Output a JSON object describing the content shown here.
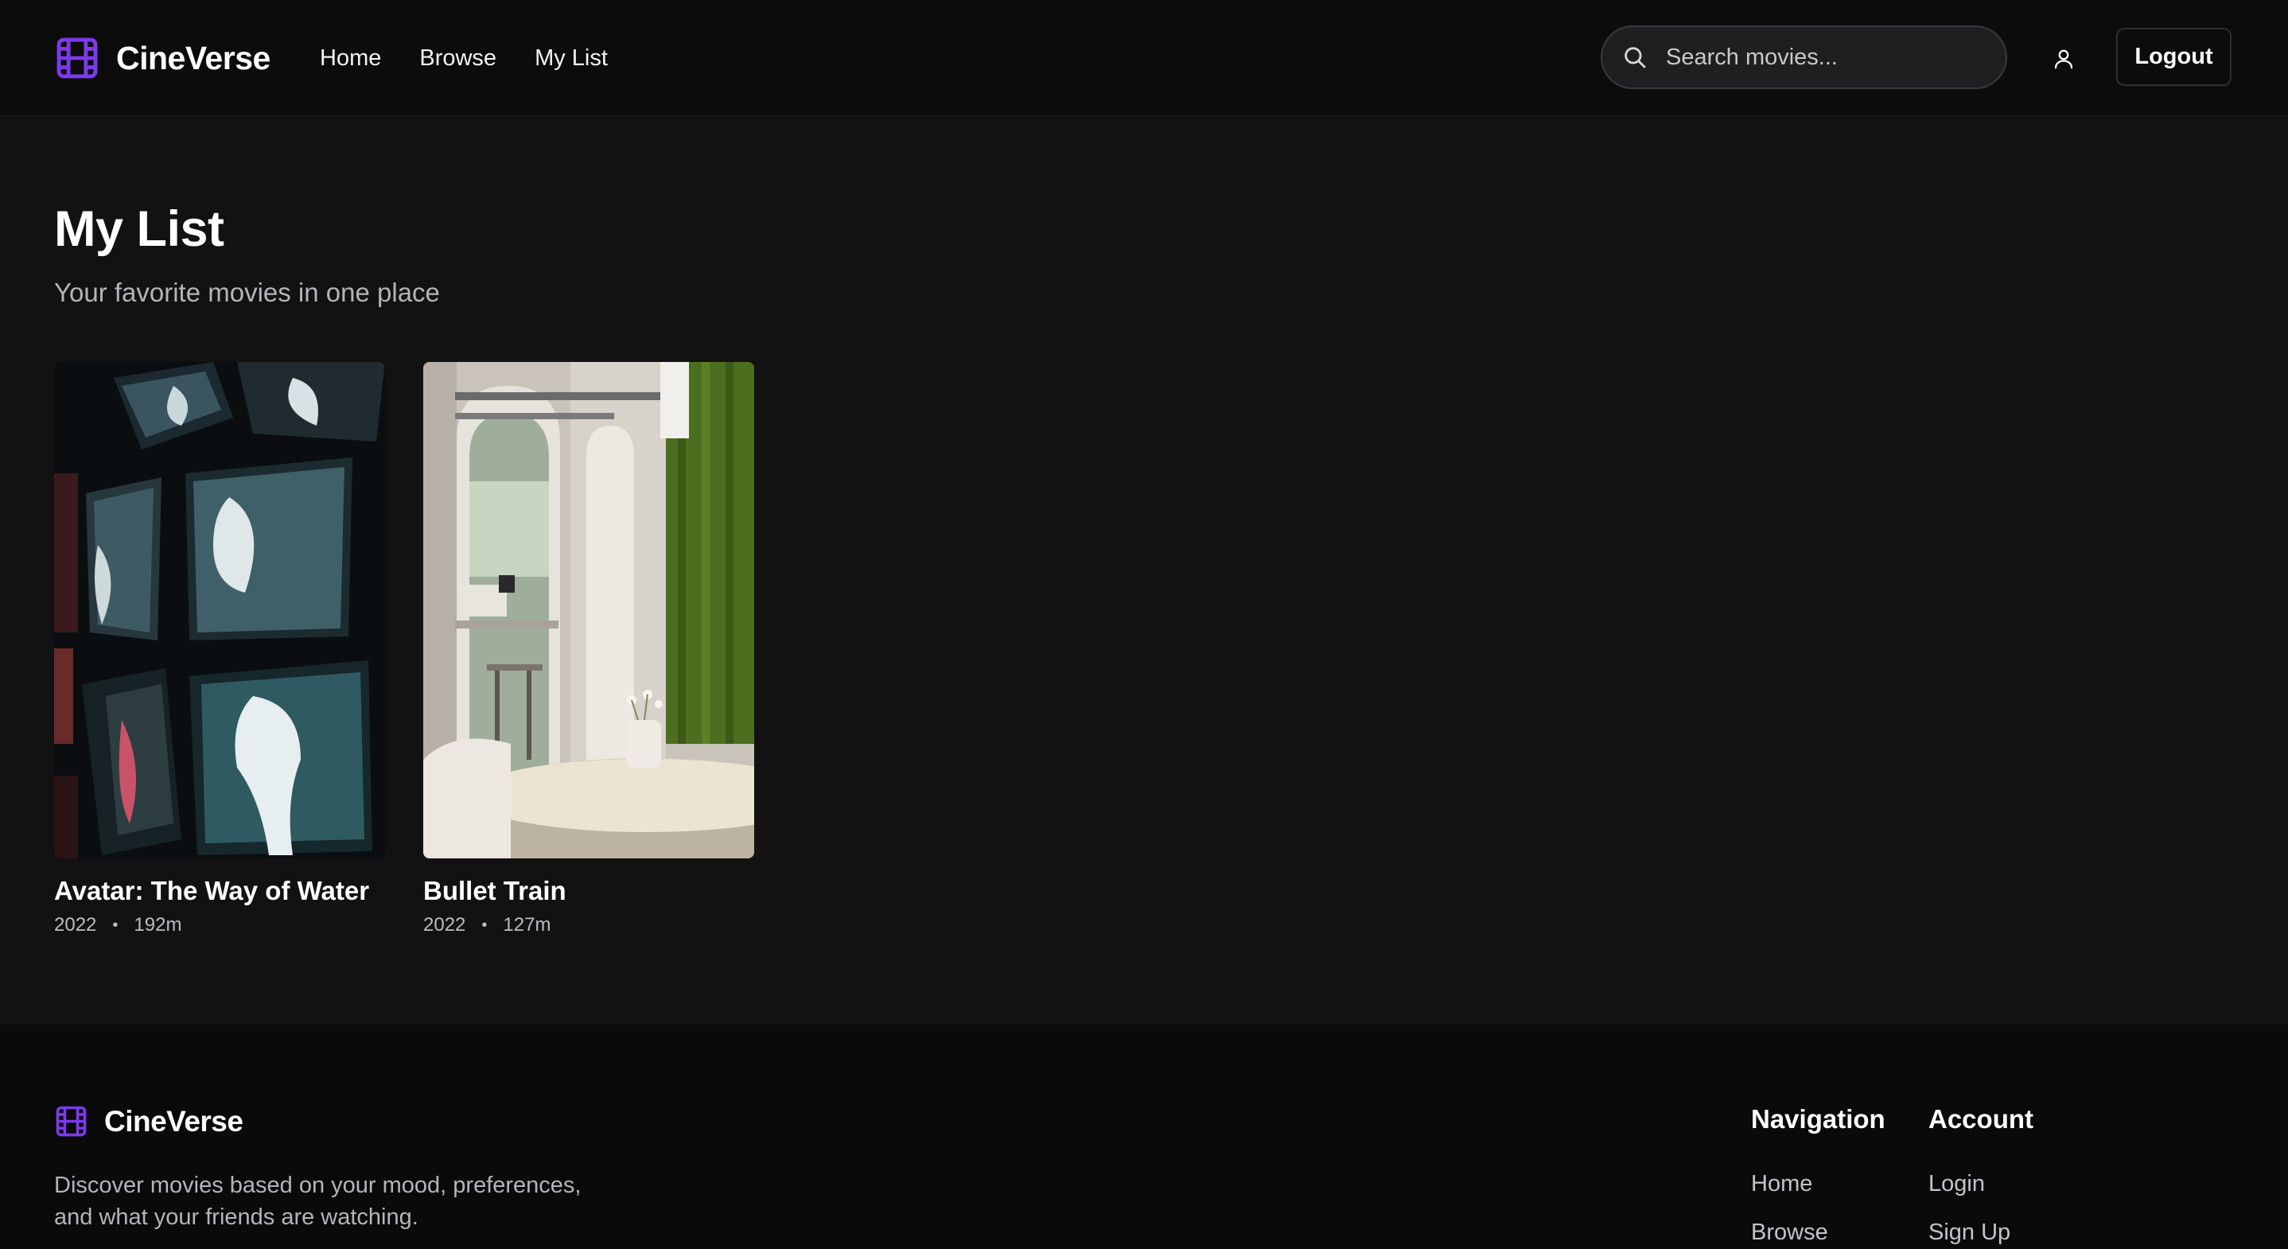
{
  "brand": {
    "name": "CineVerse",
    "accent_color": "#7c3aed"
  },
  "header": {
    "nav": [
      {
        "label": "Home"
      },
      {
        "label": "Browse"
      },
      {
        "label": "My List"
      }
    ],
    "search": {
      "placeholder": "Search movies...",
      "value": ""
    },
    "user_icon": "user-icon",
    "logout_label": "Logout"
  },
  "main": {
    "title": "My List",
    "subtitle": "Your favorite movies in one place",
    "movies": [
      {
        "title": "Avatar: The Way of Water",
        "year": "2022",
        "runtime": "192m",
        "separator": "•"
      },
      {
        "title": "Bullet Train",
        "year": "2022",
        "runtime": "127m",
        "separator": "•"
      }
    ]
  },
  "footer": {
    "description": "Discover movies based on your mood, preferences, and what your friends are watching.",
    "columns": [
      {
        "heading": "Navigation",
        "links": [
          "Home",
          "Browse"
        ]
      },
      {
        "heading": "Account",
        "links": [
          "Login",
          "Sign Up"
        ]
      }
    ]
  }
}
